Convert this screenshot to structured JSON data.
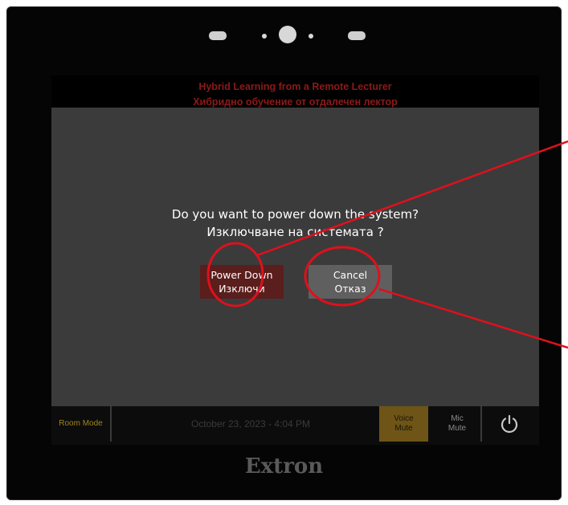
{
  "screen": {
    "header": {
      "title_en": "Hybrid Learning from a Remote Lecturer",
      "title_bg": "Хибридно обучение от отдалечен лектор"
    },
    "bottom_bar": {
      "room_mode_label": "Room Mode",
      "datetime": "October 23, 2023 - 4:04 PM",
      "voice_mute": {
        "line1": "Voice",
        "line2": "Mute"
      },
      "mic_mute": {
        "line1": "Mic",
        "line2": "Mute"
      },
      "power_icon": "power-icon"
    }
  },
  "dialog": {
    "question_en": "Do you want to power down the system?",
    "question_bg": "Изключване на системата ?",
    "power_down_button": {
      "line1": "Power Down",
      "line2": "Изключи"
    },
    "cancel_button": {
      "line1": "Cancel",
      "line2": "Отказ"
    }
  },
  "device": {
    "brand": "Extron"
  },
  "colors": {
    "annotation": "#e0101c",
    "power_down_bg": "#5a1e1c",
    "cancel_bg": "#5f5f5f",
    "voice_mute_bg": "#6e5416",
    "room_mode_text": "#a08520"
  }
}
